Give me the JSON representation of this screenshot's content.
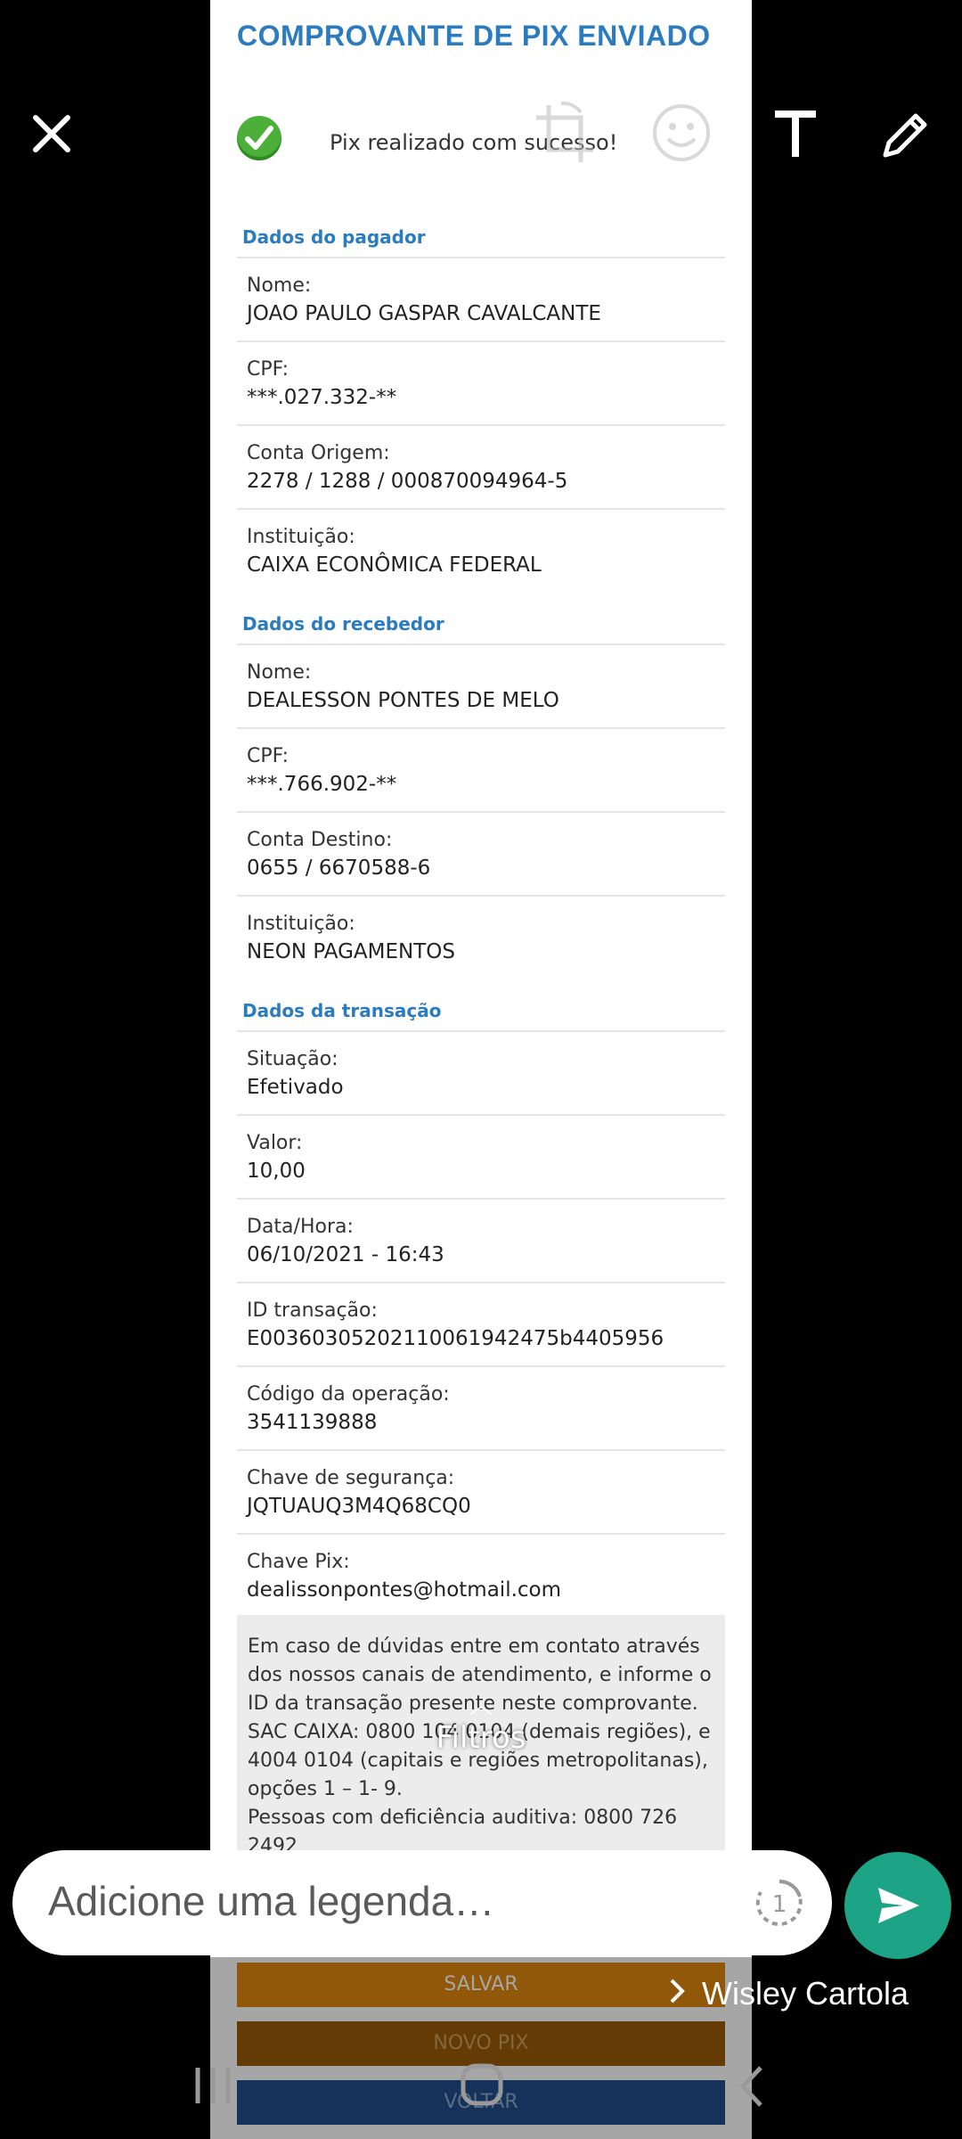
{
  "top_bar": {
    "close_icon": "close-icon",
    "crop_icon": "crop-rotate-icon",
    "emoji_icon": "emoji-icon",
    "text_icon": "text-icon",
    "draw_icon": "pencil-icon"
  },
  "receipt": {
    "title": "COMPROVANTE DE PIX ENVIADO",
    "status_text": "Pix realizado com sucesso!",
    "payer": {
      "heading": "Dados do pagador",
      "fields": [
        {
          "label": "Nome:",
          "value": "JOAO PAULO GASPAR CAVALCANTE"
        },
        {
          "label": "CPF:",
          "value": "***.027.332-**"
        },
        {
          "label": "Conta Origem:",
          "value": "2278 / 1288 / 000870094964-5"
        },
        {
          "label": "Instituição:",
          "value": "CAIXA ECONÔMICA FEDERAL"
        }
      ]
    },
    "receiver": {
      "heading": "Dados do recebedor",
      "fields": [
        {
          "label": "Nome:",
          "value": "DEALESSON PONTES DE MELO"
        },
        {
          "label": "CPF:",
          "value": "***.766.902-**"
        },
        {
          "label": "Conta Destino:",
          "value": "0655 / 6670588-6"
        },
        {
          "label": "Instituição:",
          "value": "NEON PAGAMENTOS"
        }
      ]
    },
    "transaction": {
      "heading": "Dados da transação",
      "fields": [
        {
          "label": "Situação:",
          "value": "Efetivado"
        },
        {
          "label": "Valor:",
          "value": "10,00"
        },
        {
          "label": "Data/Hora:",
          "value": "06/10/2021 - 16:43"
        },
        {
          "label": "ID transação:",
          "value": "E00360305202110061942475b4405956"
        },
        {
          "label": "Código da operação:",
          "value": "3541139888"
        },
        {
          "label": "Chave de segurança:",
          "value": "JQTUAUQ3M4Q68CQ0"
        },
        {
          "label": "Chave Pix:",
          "value": "dealissonpontes@hotmail.com"
        }
      ]
    },
    "note": {
      "line1": "Em caso de dúvidas entre em contato através dos nossos canais de atendimento, e informe o ID da transação presente neste comprovante.",
      "line2": "SAC CAIXA: 0800 104 0104 (demais regiões), e 4004 0104 (capitais e regiões metropolitanas), opções 1 – 1- 9.",
      "line3": "Pessoas com deficiência auditiva: 0800 726 2492"
    },
    "buttons": {
      "save": "SALVAR",
      "new_pix": "NOVO PIX",
      "back": "VOLTAR"
    }
  },
  "filters_label": "Filtros",
  "caption": {
    "placeholder": "Adicione uma legenda…",
    "view_once_icon": "view-once-icon"
  },
  "recipient_name": "Wisley Cartola",
  "colors": {
    "accent_blue": "#2a7bbf",
    "send_green": "#1da486",
    "button_orange": "#e0880e"
  }
}
